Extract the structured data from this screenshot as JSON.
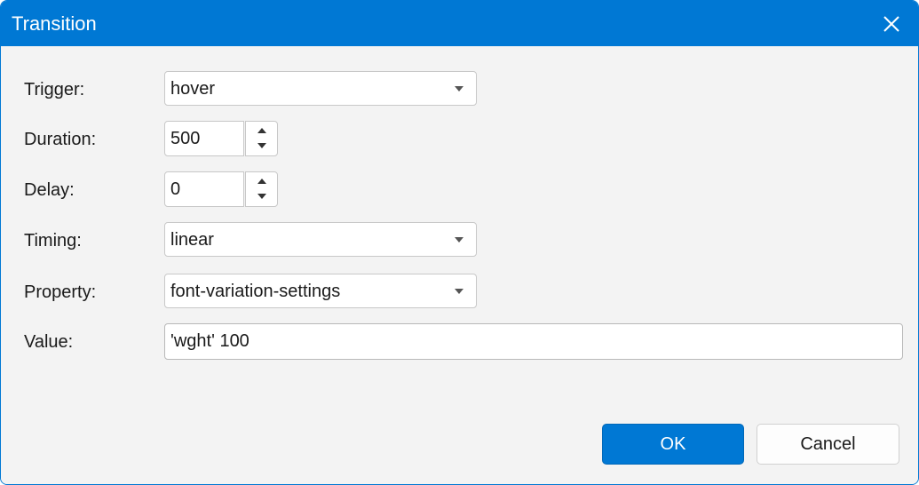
{
  "window": {
    "title": "Transition",
    "accent_color": "#0078d4",
    "close_icon": "close-icon"
  },
  "form": {
    "trigger": {
      "label": "Trigger:",
      "value": "hover"
    },
    "duration": {
      "label": "Duration:",
      "value": "500"
    },
    "delay": {
      "label": "Delay:",
      "value": "0"
    },
    "timing": {
      "label": "Timing:",
      "value": "linear"
    },
    "property": {
      "label": "Property:",
      "value": "font-variation-settings"
    },
    "value": {
      "label": "Value:",
      "value": "'wght' 100"
    }
  },
  "buttons": {
    "ok": "OK",
    "cancel": "Cancel"
  }
}
